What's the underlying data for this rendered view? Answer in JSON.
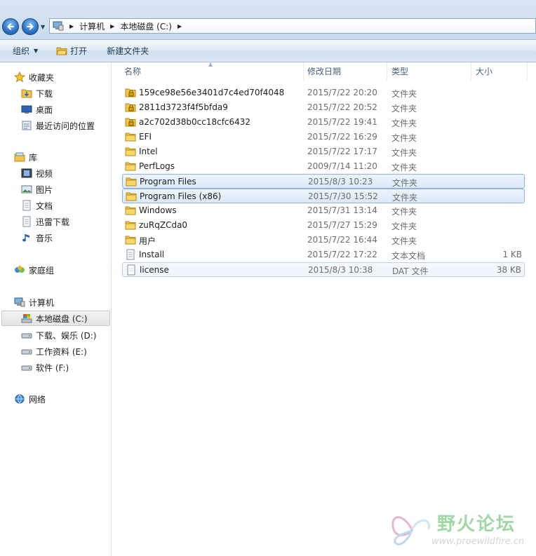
{
  "address": {
    "breadcrumbs": [
      "计算机",
      "本地磁盘 (C:)"
    ]
  },
  "toolbar": {
    "organize_label": "组织",
    "open_label": "打开",
    "new_folder_label": "新建文件夹"
  },
  "nav": {
    "favorites": "收藏夹",
    "downloads": "下载",
    "desktop": "桌面",
    "recent": "最近访问的位置",
    "libraries": "库",
    "videos": "视频",
    "pictures": "图片",
    "documents": "文档",
    "thunder": "迅雷下载",
    "music": "音乐",
    "homegroup": "家庭组",
    "computer": "计算机",
    "drive_c": "本地磁盘 (C:)",
    "drive_d": "下载、娱乐 (D:)",
    "drive_e": "工作资料 (E:)",
    "drive_f": "软件 (F:)",
    "network": "网络"
  },
  "columns": {
    "name": "名称",
    "modified": "修改日期",
    "type": "类型",
    "size": "大小"
  },
  "files": [
    {
      "name": "159ce98e56e3401d7c4ed70f4048",
      "date": "2015/7/22 20:20",
      "type": "文件夹",
      "size": "",
      "icon": "locked-folder-icon"
    },
    {
      "name": "2811d3723f4f5bfda9",
      "date": "2015/7/22 20:52",
      "type": "文件夹",
      "size": "",
      "icon": "locked-folder-icon"
    },
    {
      "name": "a2c702d38b0cc18cfc6432",
      "date": "2015/7/22 19:41",
      "type": "文件夹",
      "size": "",
      "icon": "locked-folder-icon"
    },
    {
      "name": "EFI",
      "date": "2015/7/22 16:29",
      "type": "文件夹",
      "size": "",
      "icon": "folder-icon"
    },
    {
      "name": "Intel",
      "date": "2015/7/22 17:17",
      "type": "文件夹",
      "size": "",
      "icon": "folder-icon"
    },
    {
      "name": "PerfLogs",
      "date": "2009/7/14 11:20",
      "type": "文件夹",
      "size": "",
      "icon": "folder-icon"
    },
    {
      "name": "Program Files",
      "date": "2015/8/3 10:23",
      "type": "文件夹",
      "size": "",
      "icon": "folder-icon"
    },
    {
      "name": "Program Files (x86)",
      "date": "2015/7/30 15:52",
      "type": "文件夹",
      "size": "",
      "icon": "folder-icon"
    },
    {
      "name": "Windows",
      "date": "2015/7/31 13:14",
      "type": "文件夹",
      "size": "",
      "icon": "folder-icon"
    },
    {
      "name": "zuRqZCda0",
      "date": "2015/7/27 15:29",
      "type": "文件夹",
      "size": "",
      "icon": "folder-icon"
    },
    {
      "name": "用户",
      "date": "2015/7/22 16:44",
      "type": "文件夹",
      "size": "",
      "icon": "folder-icon"
    },
    {
      "name": "Install",
      "date": "2015/7/22 17:22",
      "type": "文本文档",
      "size": "1 KB",
      "icon": "text-file-icon"
    },
    {
      "name": "license",
      "date": "2015/8/3 10:38",
      "type": "DAT 文件",
      "size": "38 KB",
      "icon": "file-icon"
    }
  ],
  "watermark": {
    "title": "野火论坛",
    "url": "www.proewildfire.cn"
  },
  "colors": {
    "selection_border": "#8fb3de",
    "folder": "#f2c54a"
  }
}
